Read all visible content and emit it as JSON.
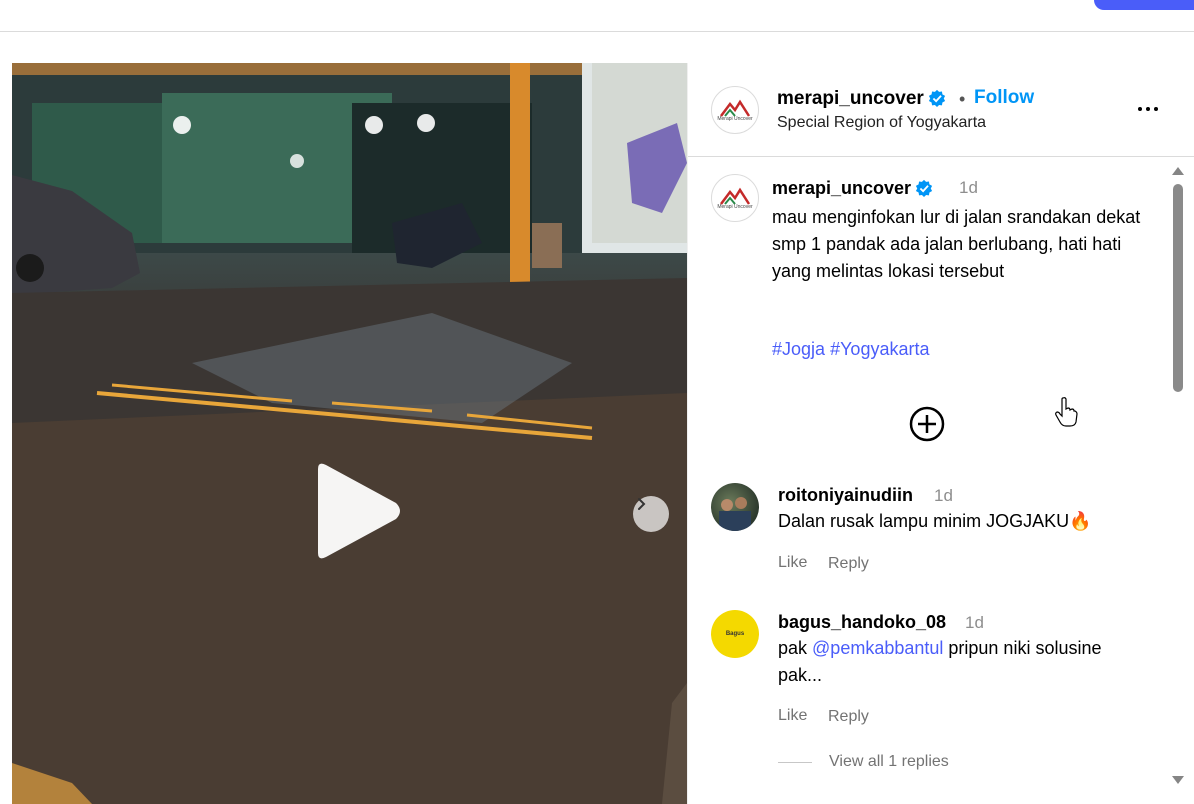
{
  "post": {
    "username": "merapi_uncover",
    "follow_label": "Follow",
    "separator": "•",
    "location": "Special Region of Yogyakarta",
    "logo_text": "Merapi Uncover"
  },
  "caption": {
    "username": "merapi_uncover",
    "time": "1d",
    "text": "mau menginfokan lur di jalan srandakan dekat smp 1 pandak ada jalan berlubang, hati hati yang melintas lokasi tersebut",
    "hashtags": [
      "#Jogja",
      "#Yogyakarta"
    ]
  },
  "comments": [
    {
      "username": "roitoniyainudiin",
      "time": "1d",
      "text": "Dalan rusak lampu minim JOGJAKU🔥",
      "like_label": "Like",
      "reply_label": "Reply"
    },
    {
      "username": "bagus_handoko_08",
      "time": "1d",
      "text_before": "pak ",
      "mention": "@pemkabbantul",
      "text_after": " pripun niki solusine pak...",
      "like_label": "Like",
      "reply_label": "Reply",
      "avatar_text": "Bagus",
      "view_replies_label": "View all 1 replies"
    }
  ],
  "colors": {
    "link": "#0095f6",
    "hashtag": "#4a5df9",
    "secondary_text": "#8e8e8e",
    "verified": "#0095f6",
    "brand_button": "#4a5df9"
  },
  "icons": {
    "verified": "verified-badge-icon",
    "more": "more-options-icon",
    "play": "play-icon",
    "next": "chevron-right-icon",
    "load_more": "plus-circle-icon",
    "cursor": "hand-pointer-icon"
  }
}
